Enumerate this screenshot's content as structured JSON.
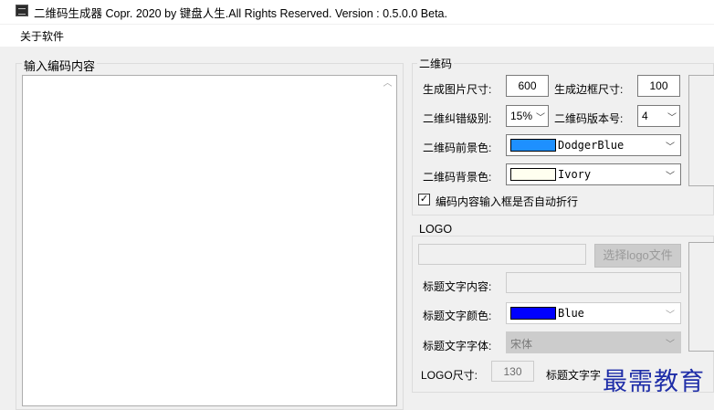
{
  "window": {
    "title": "二维码生成器  Copr. 2020 by 键盘人生.All Rights Reserved.  Version : 0.5.0.0 Beta."
  },
  "menu": {
    "about": "关于软件"
  },
  "left": {
    "group_label": "输入编码内容",
    "text_value": ""
  },
  "qrcode": {
    "group_label": "二维码",
    "image_size_label": "生成图片尺寸:",
    "image_size_value": "600",
    "border_size_label": "生成边框尺寸:",
    "border_size_value": "100",
    "ecc_label": "二维纠错级别:",
    "ecc_value": "15%",
    "version_label": "二维码版本号:",
    "version_value": "4",
    "fg_label": "二维码前景色:",
    "fg_name": "DodgerBlue",
    "fg_color": "#1e90ff",
    "bg_label": "二维码背景色:",
    "bg_name": "Ivory",
    "bg_color": "#fffff0",
    "wrap_label": "编码内容输入框是否自动折行",
    "wrap_checked": true
  },
  "logo": {
    "group_label": "LOGO",
    "path_value": "",
    "choose_button": "选择logo文件",
    "title_text_label": "标题文字内容:",
    "title_text_value": "",
    "title_color_label": "标题文字颜色:",
    "title_color_name": "Blue",
    "title_color": "#0000ff",
    "title_font_label": "标题文字字体:",
    "title_font_value": "宋体",
    "size_label": "LOGO尺寸:",
    "size_value": "130",
    "title_size_label": "标题文字字"
  },
  "watermark": {
    "text": "最需教育"
  }
}
